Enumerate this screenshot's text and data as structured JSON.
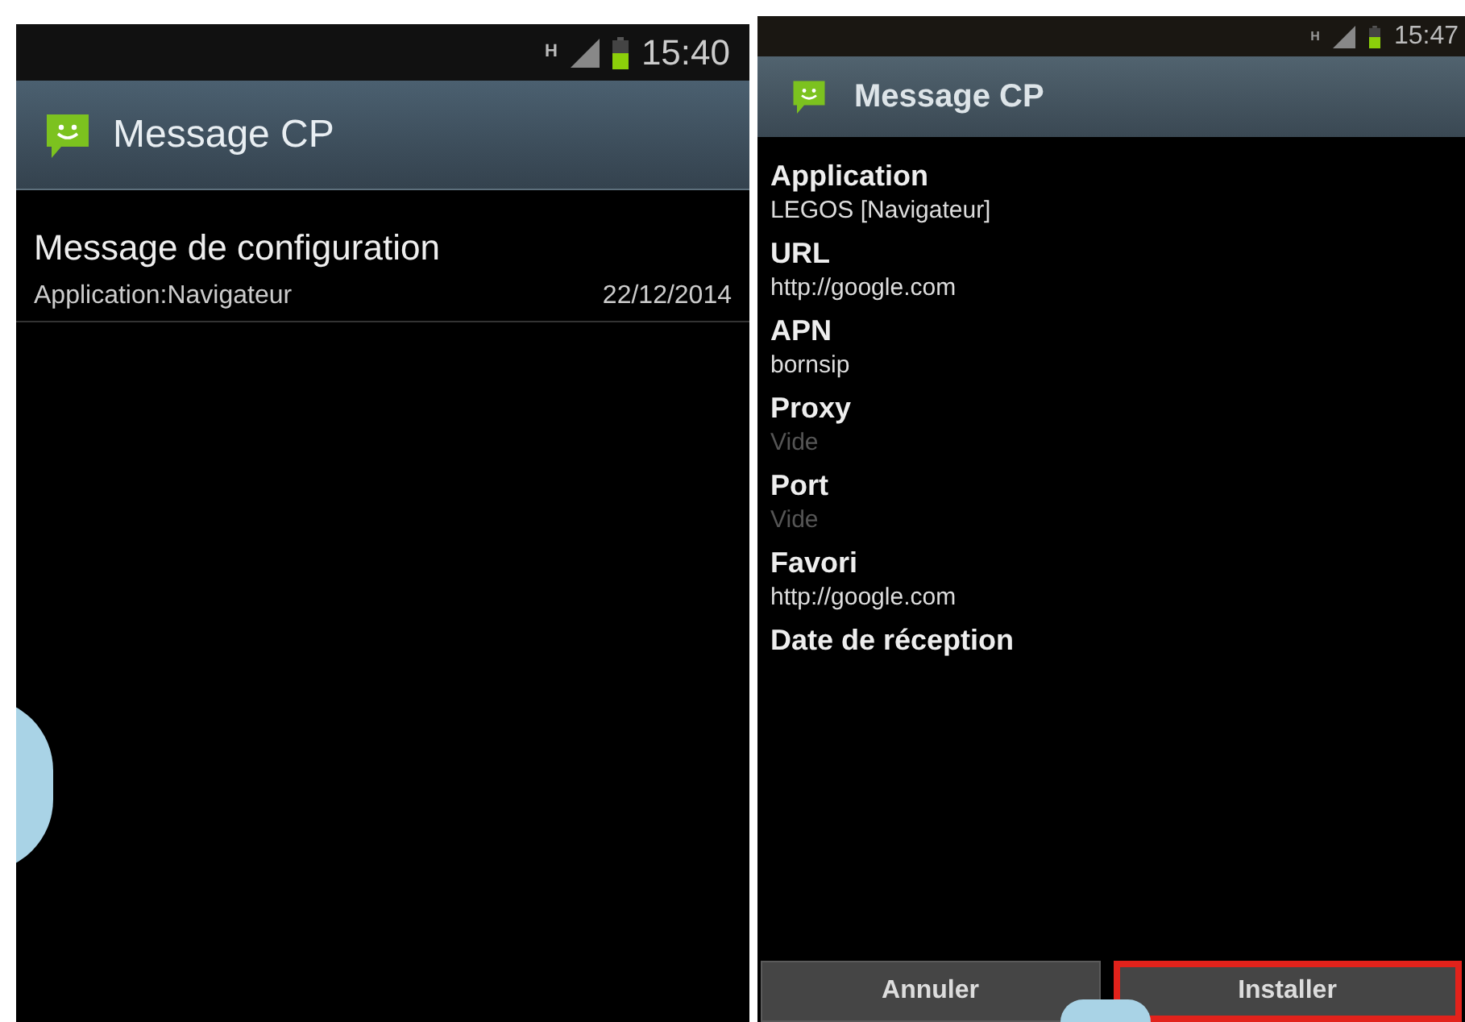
{
  "screens": [
    {
      "status_bar": {
        "network": "H",
        "time": "15:40"
      },
      "title": "Message CP",
      "messages": [
        {
          "title": "Message de configuration",
          "subtitle": "Application:Navigateur",
          "date": "22/12/2014"
        }
      ]
    },
    {
      "status_bar": {
        "network": "H",
        "time": "15:47"
      },
      "title": "Message CP",
      "fields": [
        {
          "label": "Application",
          "value": "LEGOS [Navigateur]",
          "empty": false
        },
        {
          "label": "URL",
          "value": "http://google.com",
          "empty": false
        },
        {
          "label": "APN",
          "value": "bornsip",
          "empty": false
        },
        {
          "label": "Proxy",
          "value": "Vide",
          "empty": true
        },
        {
          "label": "Port",
          "value": "Vide",
          "empty": true
        },
        {
          "label": "Favori",
          "value": "http://google.com",
          "empty": false
        },
        {
          "label": "Date de réception"
        }
      ],
      "buttons": [
        {
          "label": "Annuler",
          "highlighted": false
        },
        {
          "label": "Installer",
          "highlighted": true
        }
      ]
    }
  ]
}
